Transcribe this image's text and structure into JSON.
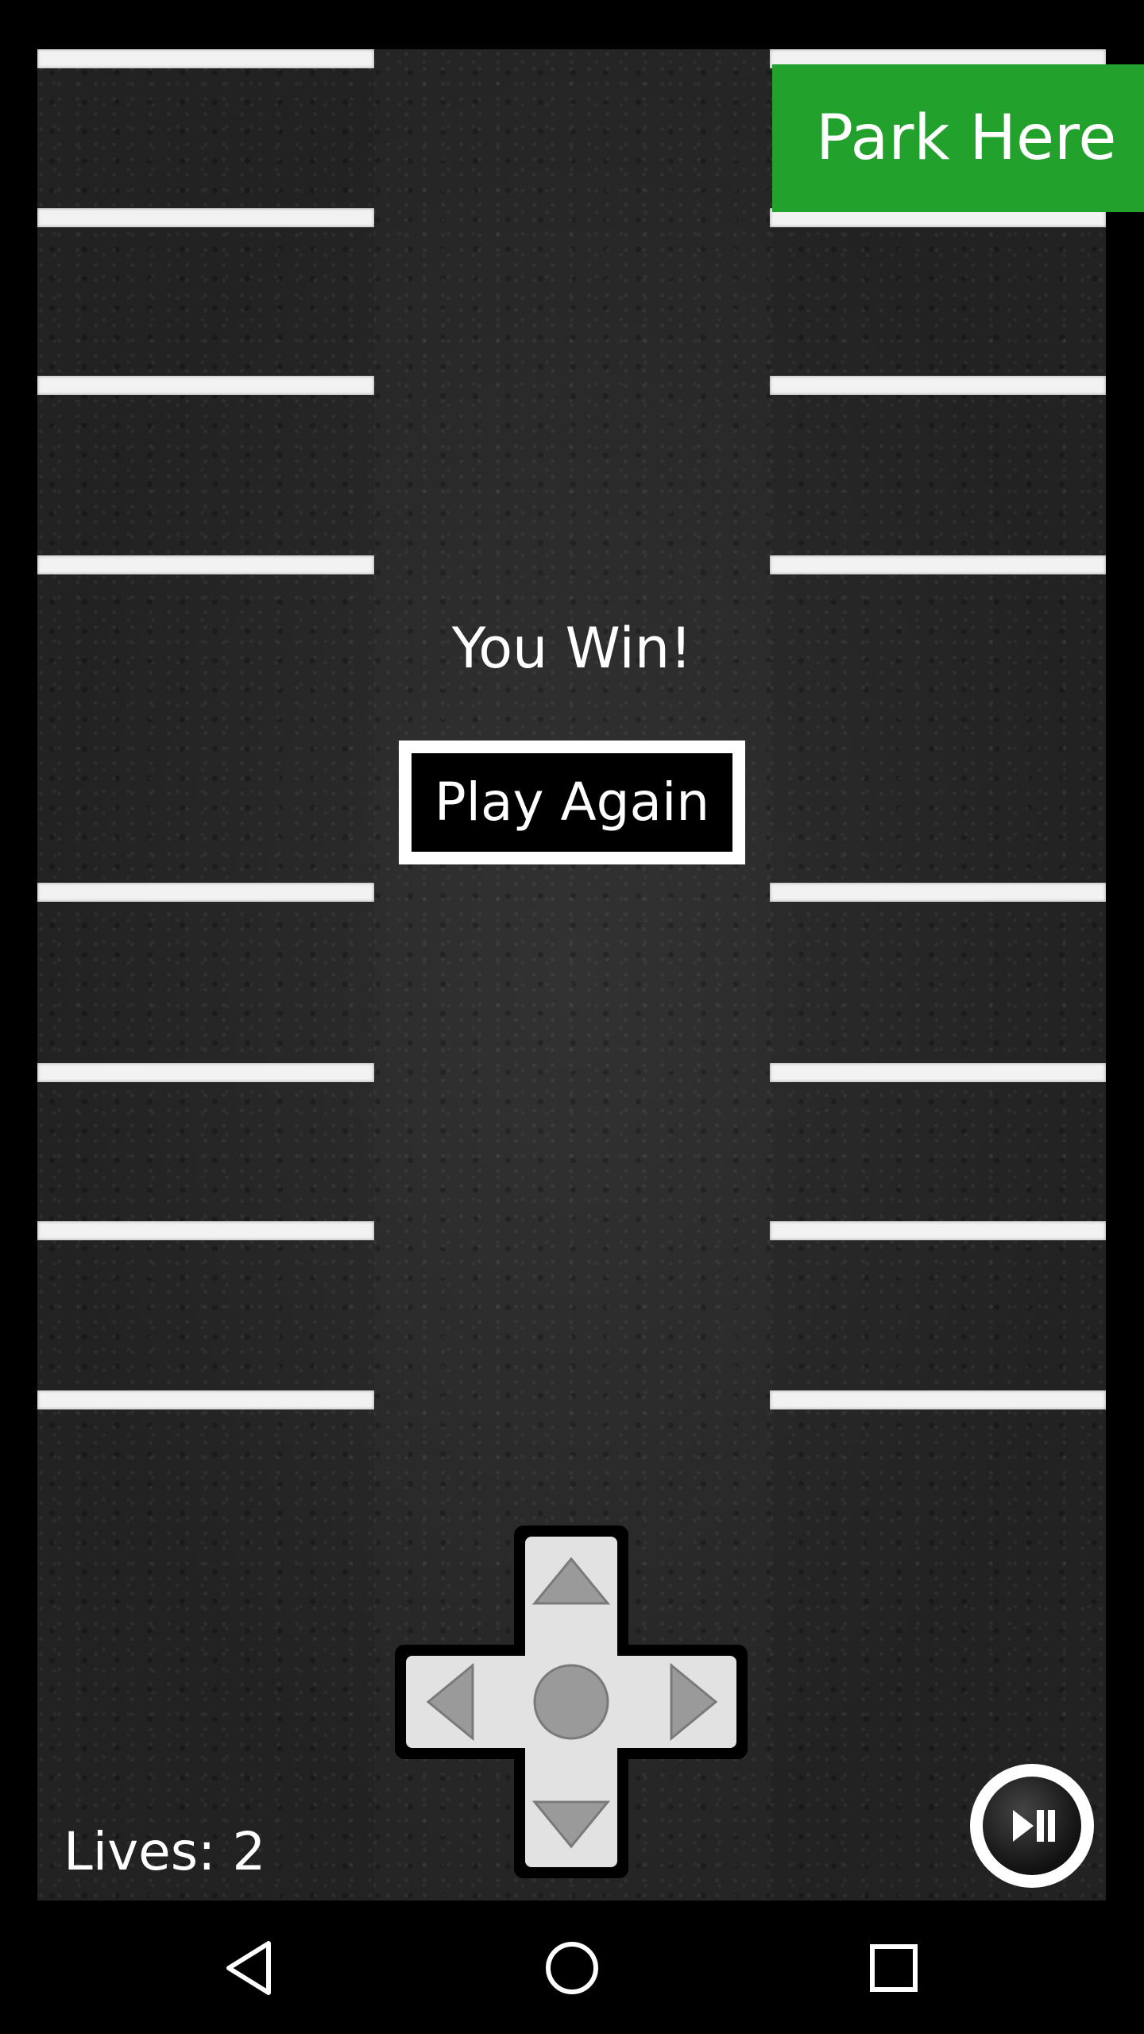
{
  "game": {
    "target_label": "Park Here",
    "message": "You Win!",
    "play_again_label": "Play Again",
    "lives_text": "Lives: 2"
  },
  "controls": {
    "dpad": [
      "up-arrow-icon",
      "left-arrow-icon",
      "center-circle-icon",
      "right-arrow-icon",
      "down-arrow-icon"
    ],
    "media_button_icon": "play-pause-icon"
  },
  "navbar": {
    "icons": [
      "back-icon",
      "home-icon",
      "recents-icon"
    ]
  },
  "colors": {
    "target": "#22a12d",
    "asphalt": "#262626",
    "stripe": "#f2f2f2",
    "dpad_face": "#e2e2e2",
    "dpad_arrow": "#999999"
  }
}
